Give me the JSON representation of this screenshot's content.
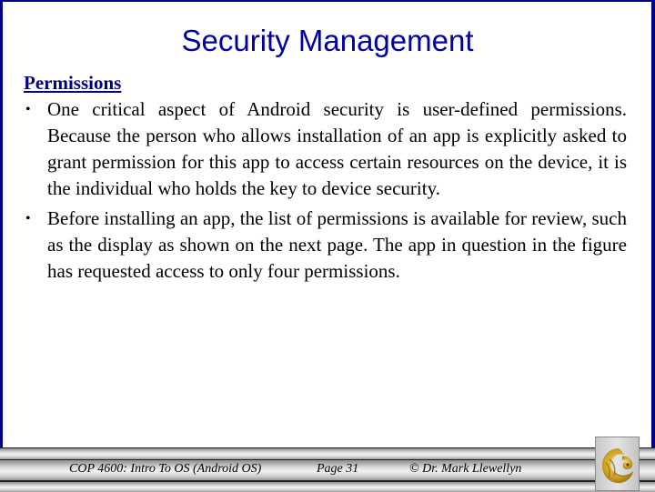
{
  "slide": {
    "title": "Security Management",
    "section_heading": "Permissions",
    "bullets": [
      "One critical aspect of Android security is user-defined permissions. Because the person who allows installation of an app is explicitly asked to grant permission for this app to access certain resources on the device, it is the individual who holds the key to device security.",
      "Before installing an app, the list of permissions is available for review, such as the display as shown on the next page.  The app in question in the figure has requested access to only four permissions."
    ],
    "bullet_glyph": "•"
  },
  "footer": {
    "course": "COP 4600: Intro To OS  (Android OS)",
    "page": "Page 31",
    "copyright": "© Dr. Mark Llewellyn",
    "logo_icon": "ucf-pegasus-logo"
  },
  "colors": {
    "frame": "#000088",
    "title": "#0000a0",
    "heading": "#000080",
    "logo_gold": "#c9a227"
  }
}
